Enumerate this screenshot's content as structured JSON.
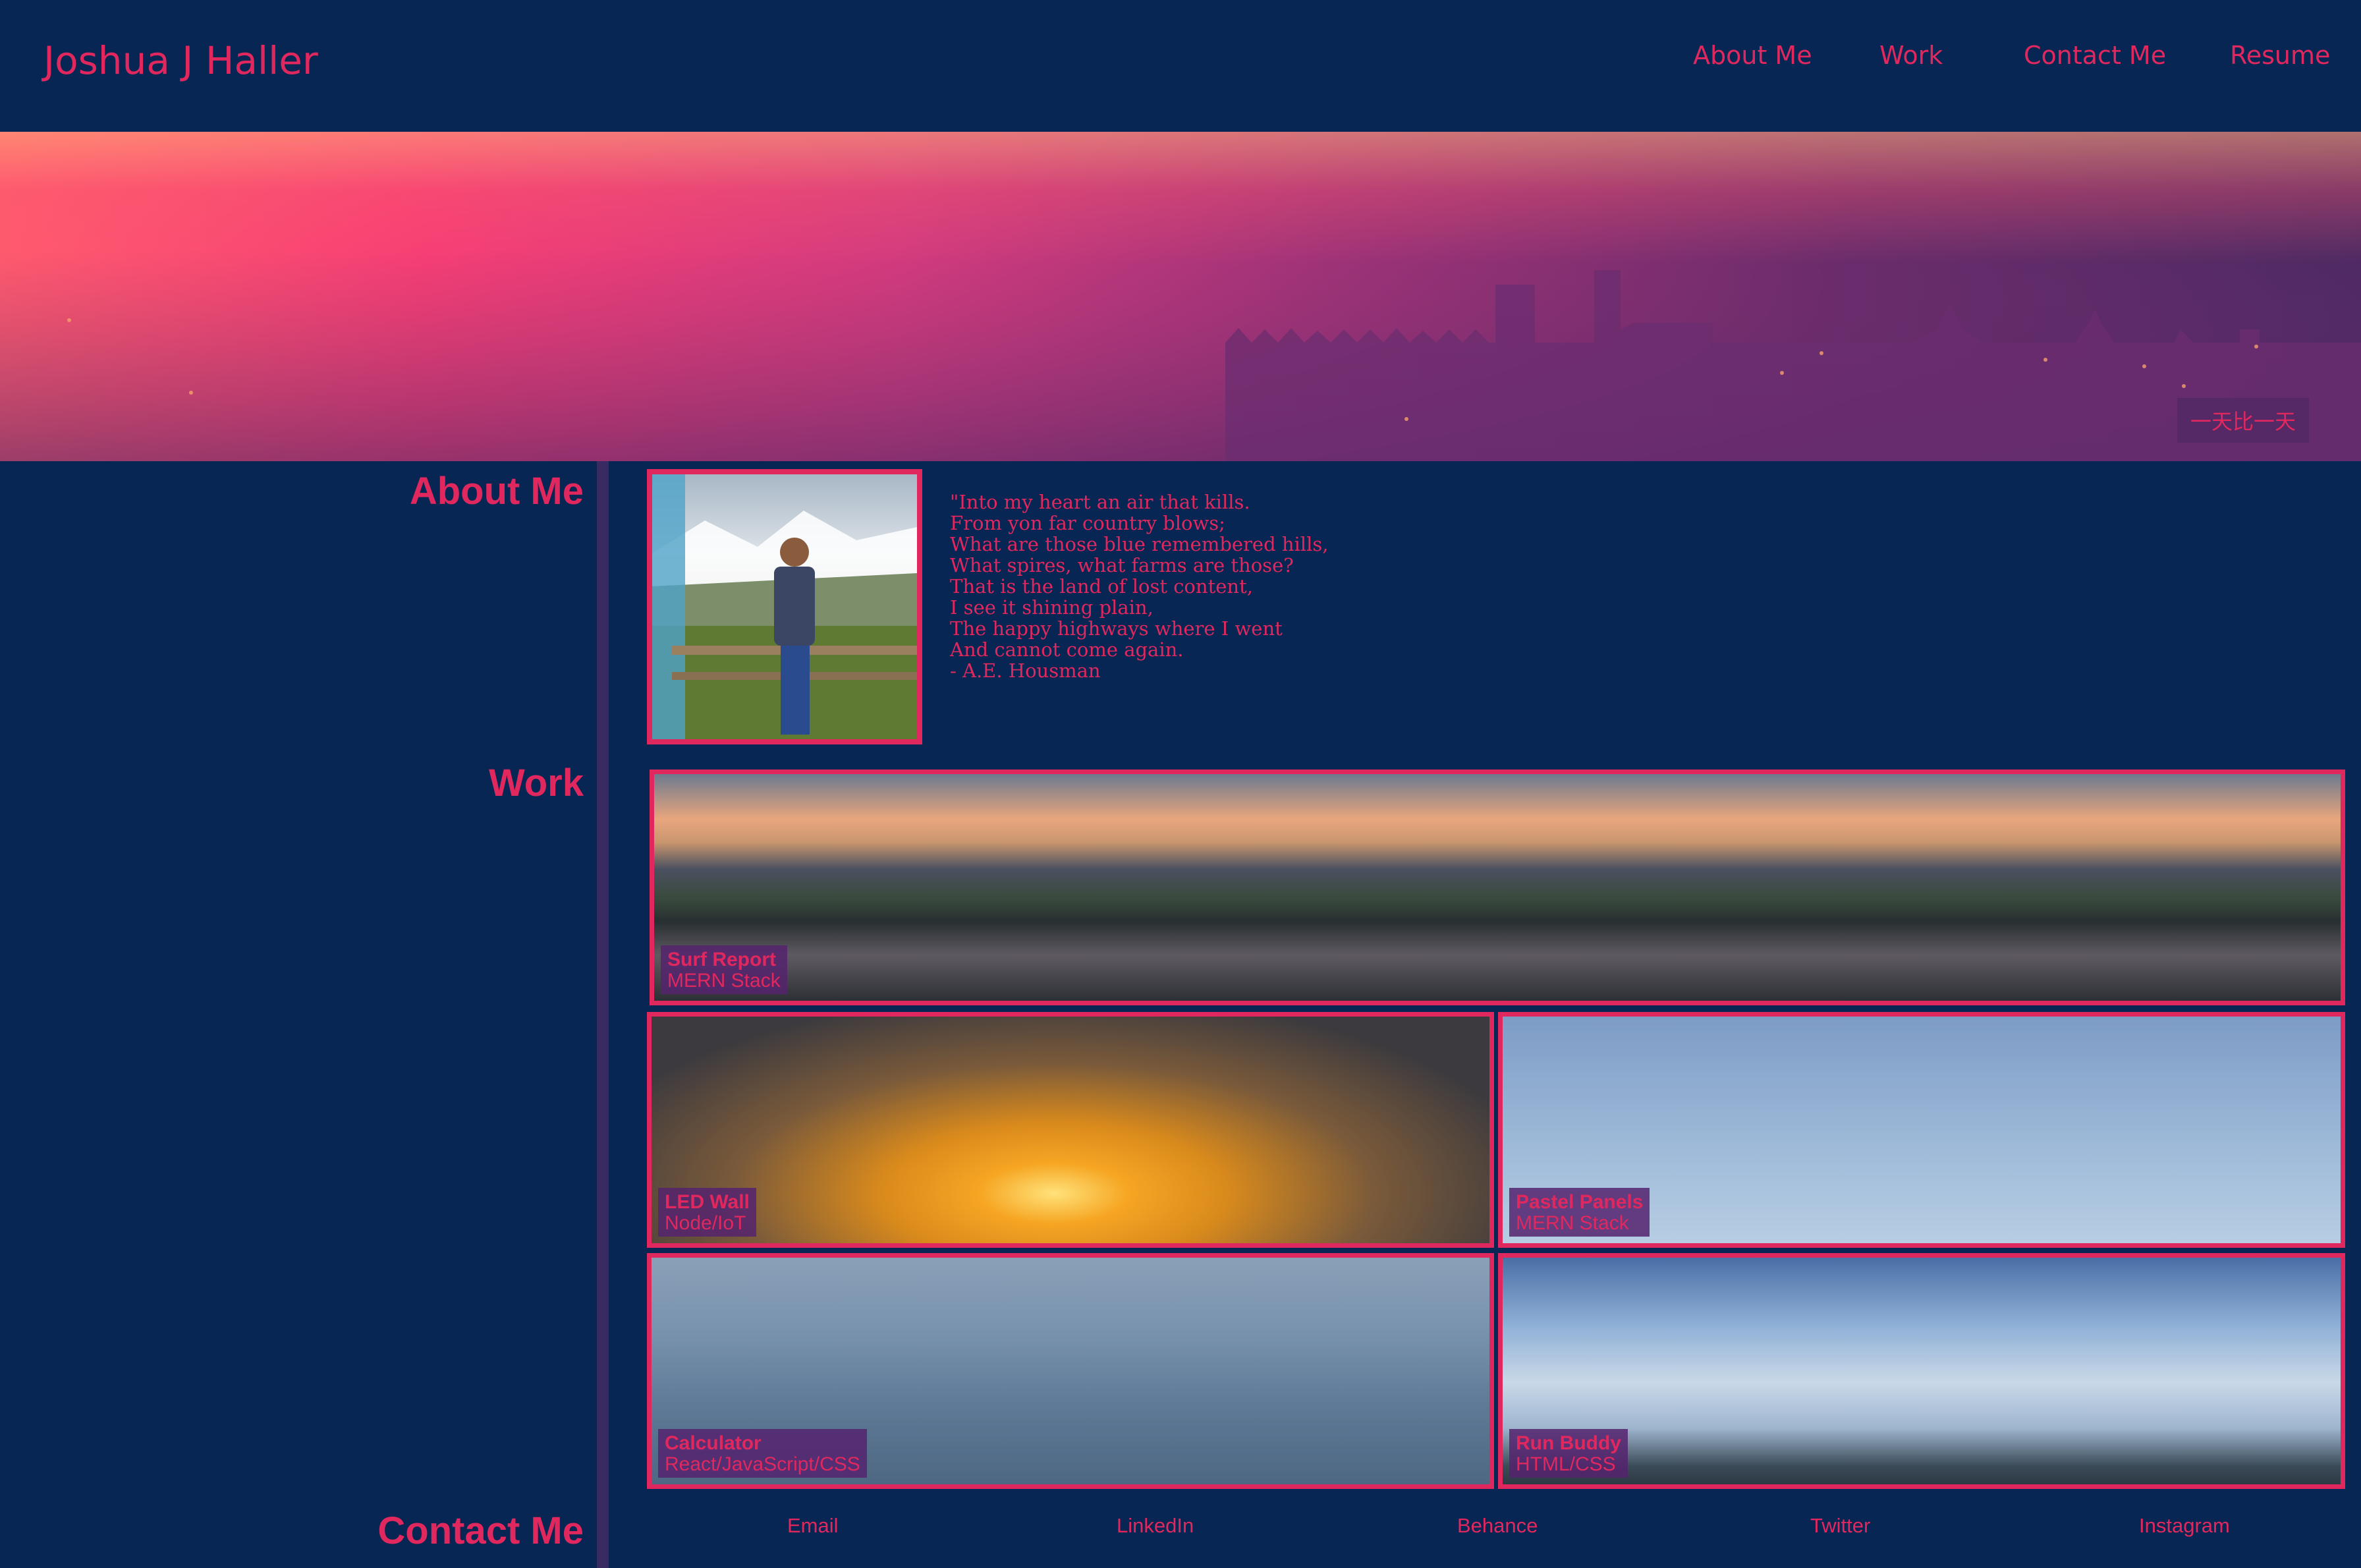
{
  "header": {
    "brand": "Joshua J Haller",
    "nav": [
      "About Me",
      "Work",
      "Contact Me",
      "Resume"
    ]
  },
  "hero": {
    "badge": "一天比一天"
  },
  "sections": {
    "about": "About Me",
    "work": "Work",
    "contact": "Contact Me"
  },
  "about": {
    "quote": "\"Into my heart an air that kills.\nFrom yon far country blows;\nWhat are those blue remembered hills,\nWhat spires, what farms are those?\nThat is the land of lost content,\nI see it shining plain,\nThe happy highways where I went\nAnd cannot come again.\n- A.E. Housman"
  },
  "work": [
    {
      "title": "Surf Report",
      "stack": "MERN Stack"
    },
    {
      "title": "LED Wall",
      "stack": "Node/IoT"
    },
    {
      "title": "Pastel Panels",
      "stack": "MERN Stack"
    },
    {
      "title": "Calculator",
      "stack": "React/JavaScript/CSS"
    },
    {
      "title": "Run Buddy",
      "stack": "HTML/CSS"
    }
  ],
  "contact": {
    "links": [
      "Email",
      "LinkedIn",
      "Behance",
      "Twitter",
      "Instagram"
    ]
  },
  "colors": {
    "background": "#082653",
    "accent": "#e0285f",
    "label_bg": "#55236e"
  }
}
